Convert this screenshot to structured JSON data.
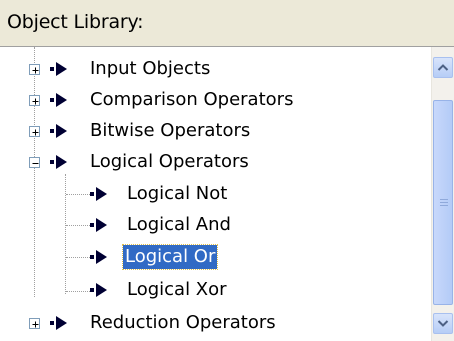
{
  "header": {
    "title": "Object Library:"
  },
  "tree": {
    "items": [
      {
        "label": "Input Objects",
        "level": 0,
        "expander": "plus"
      },
      {
        "label": "Comparison Operators",
        "level": 0,
        "expander": "plus"
      },
      {
        "label": "Bitwise Operators",
        "level": 0,
        "expander": "plus"
      },
      {
        "label": "Logical Operators",
        "level": 0,
        "expander": "minus"
      },
      {
        "label": "Logical Not",
        "level": 1
      },
      {
        "label": "Logical And",
        "level": 1
      },
      {
        "label": "Logical Or",
        "level": 1,
        "selected": true
      },
      {
        "label": "Logical Xor",
        "level": 1
      },
      {
        "label": "Reduction Operators",
        "level": 0,
        "expander": "plus"
      }
    ]
  },
  "icons": {
    "node": "arrow-bullet-icon",
    "expand": "plus-box-icon",
    "collapse": "minus-box-icon",
    "scroll_up": "scroll-up-arrow-icon",
    "scroll_down": "scroll-down-arrow-icon"
  },
  "colors": {
    "header_bg": "#ece9d8",
    "selection": "#316ac5",
    "arrow": "#000033",
    "scrollbar_button": "#b6cdf6"
  }
}
